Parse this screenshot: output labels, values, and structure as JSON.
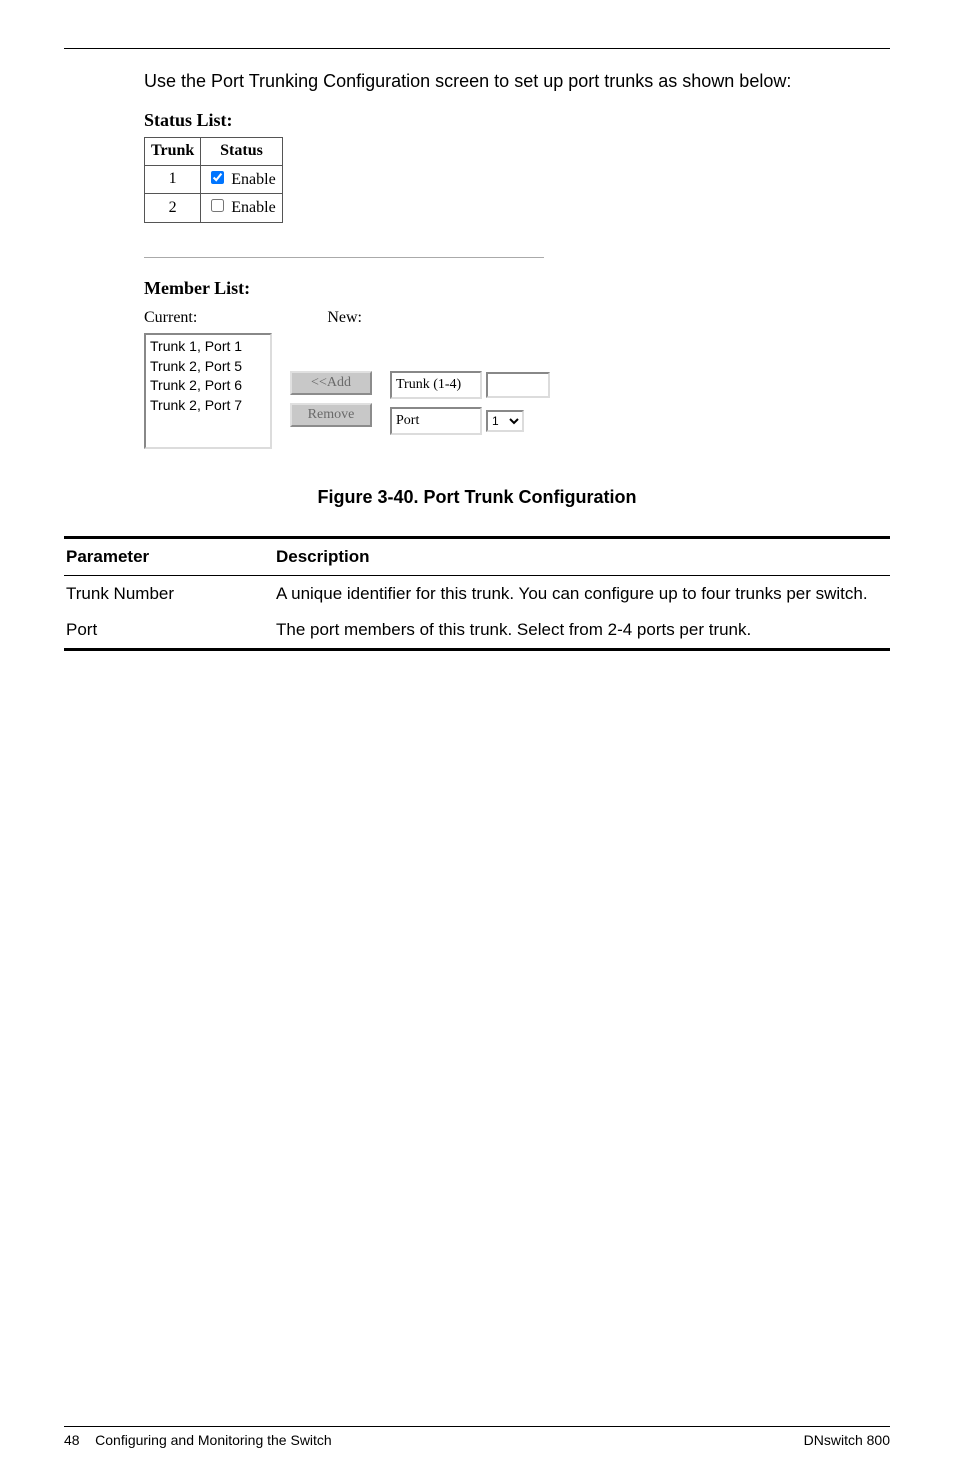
{
  "intro": {
    "text": "Use the Port Trunking Configuration screen to set up port trunks as shown below:"
  },
  "status_list": {
    "heading": "Status List:",
    "headers": {
      "trunk": "Trunk",
      "status": "Status"
    },
    "rows": [
      {
        "trunk": "1",
        "enabled": true,
        "label": "Enable"
      },
      {
        "trunk": "2",
        "enabled": false,
        "label": "Enable"
      }
    ]
  },
  "member_list": {
    "heading": "Member List:",
    "current_label": "Current:",
    "new_label": "New:",
    "current_items": [
      "Trunk 1, Port 1",
      "Trunk 2, Port 5",
      "Trunk 2, Port 6",
      "Trunk 2, Port 7"
    ],
    "add_button": "<<Add",
    "remove_button": "Remove",
    "trunk_field_label": "Trunk (1-4)",
    "trunk_field_value": "",
    "port_field_label": "Port",
    "port_options": [
      "1"
    ],
    "port_selected": "1"
  },
  "figure_caption": "Figure 3-40.  Port Trunk Configuration",
  "param_table": {
    "headers": {
      "param": "Parameter",
      "desc": "Description"
    },
    "rows": [
      {
        "param": "Trunk Number",
        "desc": "A unique identifier for this trunk. You can configure up to four trunks per switch."
      },
      {
        "param": "Port",
        "desc": "The port members of this trunk. Select from 2-4 ports per trunk."
      }
    ]
  },
  "footer": {
    "left_page": "48",
    "left_text": "Configuring and Monitoring the Switch",
    "right_text": "DNswitch 800"
  }
}
